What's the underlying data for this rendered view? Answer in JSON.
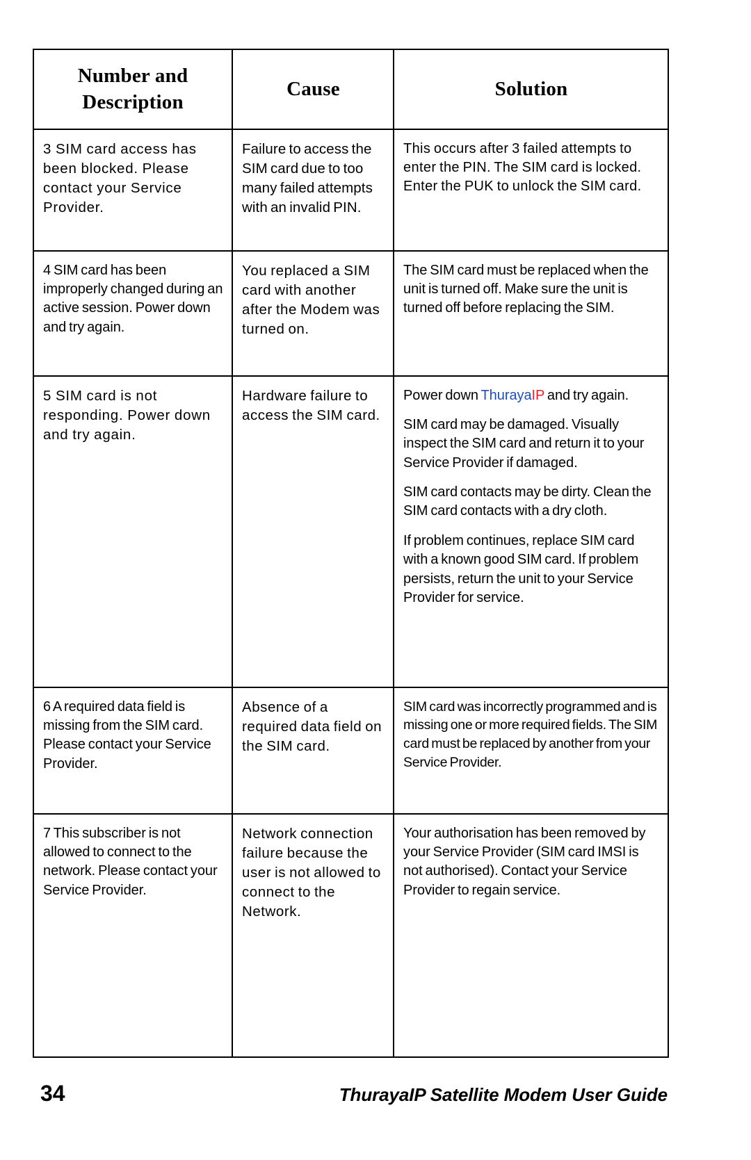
{
  "page": {
    "number": "34",
    "footer_title": "ThurayaIP Satellite Modem User Guide"
  },
  "colors": {
    "brand_thuraya_blue": "#1C4CC4",
    "brand_ip_red": "#ED1C24",
    "table_border": "#000000",
    "text": "#000000",
    "background": "#FFFFFF"
  },
  "table": {
    "headers": {
      "number_line1": "Number and",
      "number_line2": "Description",
      "cause": "Cause",
      "solution": "Solution"
    },
    "rows": [
      {
        "id": "row-3",
        "number_description": "3 SIM card access has been blocked. Please contact your Service Provider.",
        "cause": "Failure to access the SIM card due to too many failed attempts with an invalid PIN.",
        "solution_paragraphs": [
          "This occurs after 3 failed attempts to enter the PIN. The SIM card is locked. Enter the PUK to unlock the SIM card."
        ]
      },
      {
        "id": "row-4",
        "number_description": "4 SIM card has been improperly changed during an active session. Power down and try again.",
        "cause": "You replaced a SIM card with another after the Modem was turned on.",
        "solution_paragraphs": [
          "The SIM card must be replaced when the unit is turned off. Make sure the unit is turned off before replacing the SIM."
        ]
      },
      {
        "id": "row-5",
        "number_description": "5 SIM card is not responding. Power down and try again.",
        "cause": "Hardware failure to access the SIM card.",
        "solution_paragraphs": [
          "Power down Thuraya IP and try again.",
          "SIM card may be damaged. Visually inspect the SIM card and return it to your Service Provider if damaged.",
          "SIM card contacts may be dirty. Clean the SIM card contacts with a dry cloth.",
          "If problem continues, replace SIM card with a known good SIM card. If problem persists, return the unit to your Service Provider for service."
        ],
        "solution_p1_prefix": "Power down ",
        "solution_p1_brand_thuraya": "Thuraya",
        "solution_p1_brand_ip": "IP",
        "solution_p1_suffix": " and try again."
      },
      {
        "id": "row-6",
        "number_description": "6 A required data field is missing from the SIM card. Please contact your Service Provider.",
        "cause": "Absence of a required data field on the SIM card.",
        "solution_paragraphs": [
          "SIM card was incorrectly programmed and is missing one or more required fields. The SIM card must be replaced by another from your Service Provider."
        ]
      },
      {
        "id": "row-7",
        "number_description": "7 This subscriber is not allowed to connect to the network. Please contact your Service Provider.",
        "cause": "Network connection failure because the user is not allowed to connect to the Network.",
        "solution_paragraphs": [
          "Your authorisation has been removed by your Service Provider (SIM card IMSI is not authorised). Contact your Service Provider to regain service."
        ]
      }
    ]
  }
}
